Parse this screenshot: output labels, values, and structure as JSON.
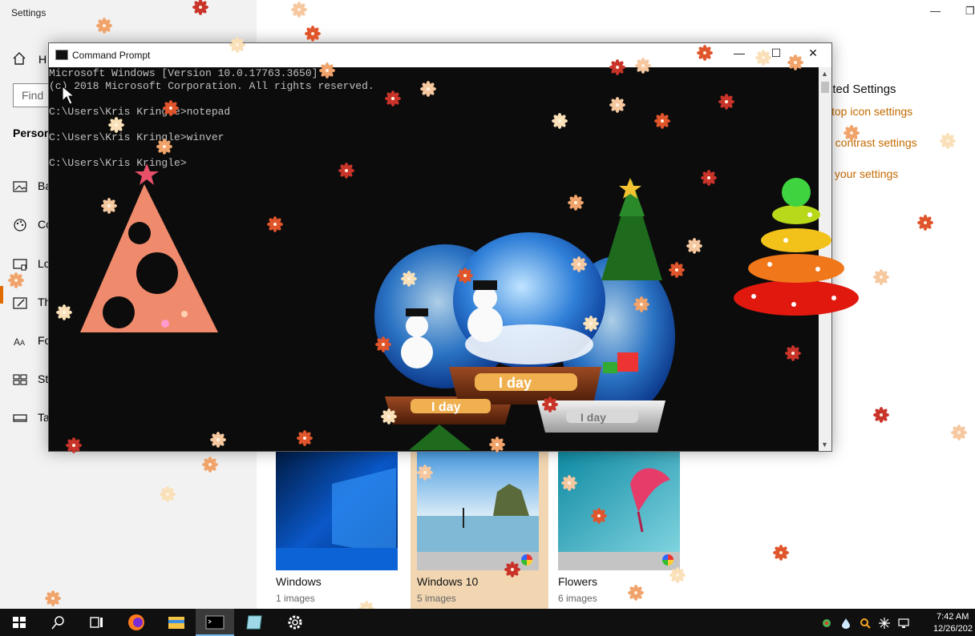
{
  "settings": {
    "window_title": "Settings",
    "nav_home_label": "H",
    "find_placeholder": "Find",
    "section_label": "Person",
    "nav_items": [
      {
        "label": "Ba",
        "icon": "picture-icon"
      },
      {
        "label": "Co",
        "icon": "palette-icon"
      },
      {
        "label": "Lo",
        "icon": "lock-screen-icon"
      },
      {
        "label": "Th",
        "icon": "themes-icon"
      },
      {
        "label": "Fo",
        "icon": "fonts-icon"
      },
      {
        "label": "St",
        "icon": "start-icon"
      },
      {
        "label": "Ta",
        "icon": "taskbar-icon"
      }
    ],
    "related": {
      "title": "ated Settings",
      "links": [
        "ktop icon settings",
        "h contrast settings",
        "c your settings"
      ]
    },
    "themes": [
      {
        "name": "Windows",
        "count": "1 images",
        "selected": false
      },
      {
        "name": "Windows 10",
        "count": "5 images",
        "selected": true
      },
      {
        "name": "Flowers",
        "count": "6 images",
        "selected": false
      }
    ],
    "accent_color": "#c46a00"
  },
  "cmd": {
    "title": "Command Prompt",
    "lines": [
      "Microsoft Windows [Version 10.0.17763.3650]",
      "(c) 2018 Microsoft Corporation. All rights reserved.",
      "",
      "C:\\Users\\Kris Kringle>notepad",
      "",
      "C:\\Users\\Kris Kringle>winver",
      "",
      "C:\\Users\\Kris Kringle>"
    ],
    "minimize": "—",
    "maximize": "☐",
    "close": "✕"
  },
  "decorations": {
    "globe_labels": [
      "I day",
      "I day",
      "I day"
    ]
  },
  "taskbar": {
    "apps": [
      "windows-start-icon",
      "search-icon",
      "task-view-icon",
      "firefox-icon",
      "file-explorer-icon",
      "command-prompt-icon",
      "notepad-icon",
      "settings-gear-icon"
    ],
    "tray": [
      "network-icon",
      "water-drop-icon",
      "search-tray-icon",
      "snowflake-icon",
      "desktop-icon"
    ],
    "time": "7:42 AM",
    "date": "12/26/202"
  }
}
